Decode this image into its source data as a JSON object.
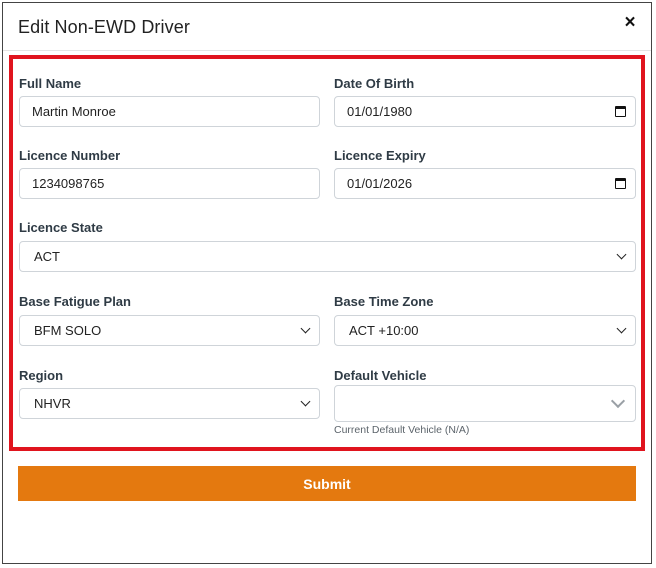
{
  "dialog": {
    "title": "Edit Non-EWD Driver",
    "close_label": "×"
  },
  "form": {
    "full_name": {
      "label": "Full Name",
      "value": "Martin Monroe"
    },
    "date_of_birth": {
      "label": "Date Of Birth",
      "value": "01/01/1980"
    },
    "licence_number": {
      "label": "Licence Number",
      "value": "1234098765"
    },
    "licence_expiry": {
      "label": "Licence Expiry",
      "value": "01/01/2026"
    },
    "licence_state": {
      "label": "Licence State",
      "value": "ACT"
    },
    "base_fatigue_plan": {
      "label": "Base Fatigue Plan",
      "value": "BFM SOLO"
    },
    "base_time_zone": {
      "label": "Base Time Zone",
      "value": "ACT +10:00"
    },
    "region": {
      "label": "Region",
      "value": "NHVR"
    },
    "default_vehicle": {
      "label": "Default Vehicle",
      "value": "",
      "hint": "Current Default Vehicle (N/A)"
    },
    "submit_label": "Submit"
  },
  "colors": {
    "highlight": "#e0141e",
    "submit": "#e4790f"
  },
  "icons": {
    "close": "close-icon",
    "calendar": "calendar-icon",
    "dropdown": "chevron-down-icon"
  }
}
